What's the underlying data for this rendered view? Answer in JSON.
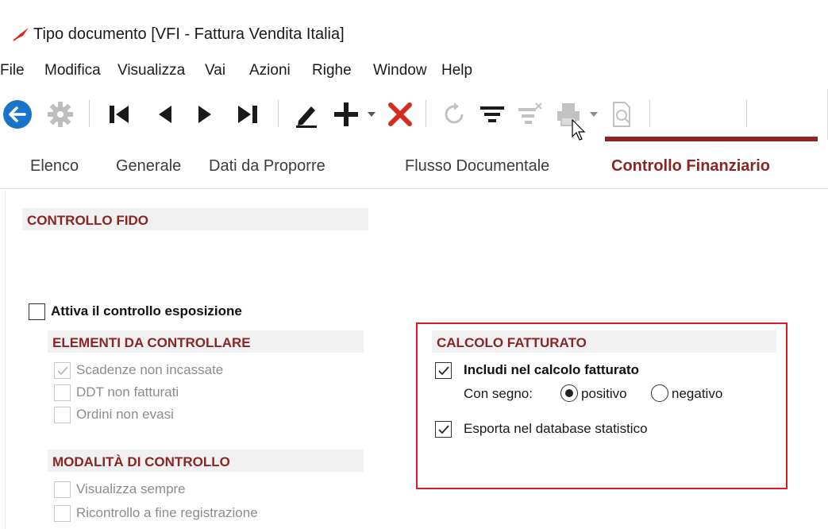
{
  "window": {
    "title": "Tipo documento [VFI - Fattura Vendita Italia]",
    "app_icon": "pen-nib-icon"
  },
  "menu": {
    "items": [
      "File",
      "Modifica",
      "Visualizza",
      "Vai",
      "Azioni",
      "Righe",
      "Window",
      "Help"
    ]
  },
  "toolbar": {
    "icons": [
      "back-icon",
      "gear-icon",
      "first-record-icon",
      "previous-record-icon",
      "next-record-icon",
      "last-record-icon",
      "edit-icon",
      "add-icon",
      "dropdown-arrow-icon",
      "delete-icon",
      "refresh-icon",
      "filter-icon",
      "clear-filter-icon",
      "print-icon",
      "print-preview-icon"
    ],
    "colors": {
      "back": "#1a73c8",
      "delete": "#d42a20",
      "disabled": "#b8b8b8",
      "dark": "#1a1a1a"
    }
  },
  "tabs": [
    {
      "label": "Elenco",
      "active": false
    },
    {
      "label": "Generale",
      "active": false
    },
    {
      "label": "Dati da Proporre",
      "active": false
    },
    {
      "label": "Flusso Documentale",
      "active": false
    },
    {
      "label": "Controllo Finanziario",
      "active": true
    }
  ],
  "controllo_fido": {
    "title": "CONTROLLO FIDO",
    "attiva": {
      "label": "Attiva il controllo esposizione",
      "checked": false
    },
    "elementi": {
      "title": "ELEMENTI DA CONTROLLARE",
      "items": [
        {
          "label": "Scadenze non incassate",
          "checked": true
        },
        {
          "label": "DDT non fatturati",
          "checked": false
        },
        {
          "label": "Ordini non evasi",
          "checked": false
        }
      ]
    },
    "modalita": {
      "title": "MODALITÀ DI CONTROLLO",
      "items": [
        {
          "label": "Visualizza sempre",
          "checked": false
        },
        {
          "label": "Ricontrollo a fine registrazione",
          "checked": false
        }
      ]
    }
  },
  "calcolo_fatturato": {
    "title": "CALCOLO FATTURATO",
    "includi": {
      "label": "Includi nel calcolo fatturato",
      "checked": true
    },
    "segno": {
      "label": "Con segno:",
      "options": [
        {
          "label": "positivo",
          "selected": true
        },
        {
          "label": "negativo",
          "selected": false
        }
      ]
    },
    "esporta": {
      "label": "Esporta nel database statistico",
      "checked": true
    }
  },
  "accent_color": "#8b2525",
  "highlight_color": "#e01b24"
}
